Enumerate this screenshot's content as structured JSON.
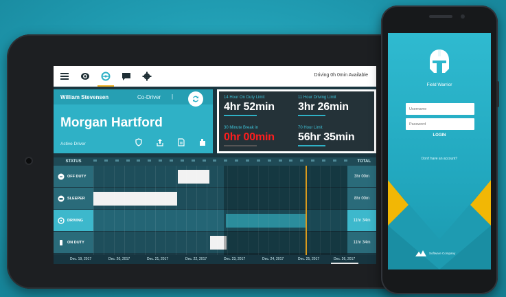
{
  "tablet": {
    "topbar": {
      "icons": [
        "menu-icon",
        "eye-icon",
        "steering-wheel-icon",
        "chat-icon",
        "gear-icon"
      ],
      "availability": "Driving 0h 0min Available"
    },
    "driver_card": {
      "driver": "William Stevensen",
      "codriver_label": "Co-Driver",
      "codriver_sep": "|",
      "name": "Morgan Hartford",
      "role": "Active Driver"
    },
    "limits": [
      {
        "label": "14 Hour On Duty Limit",
        "value": "4hr 52min"
      },
      {
        "label": "11 Hour Driving Limit",
        "value": "3hr 26min"
      },
      {
        "label": "30 Minute Break in",
        "value": "0hr 00min",
        "color": "#ff1e1e"
      },
      {
        "label": "70 Hour Limit",
        "value": "56hr 35min"
      }
    ],
    "grid": {
      "status_header": "STATUS",
      "total_header": "TOTAL",
      "rows": [
        {
          "label": "OFF DUTY",
          "total": "3hr 00m"
        },
        {
          "label": "SLEEPER",
          "total": "8hr 00m"
        },
        {
          "label": "DRIVING",
          "total": "11hr 34m"
        },
        {
          "label": "ON DUTY",
          "total": "11hr 34m"
        }
      ],
      "dates": [
        "Dec. 19, 2017",
        "Dec. 20, 2017",
        "Dec. 21, 2017",
        "Dec. 22, 2017",
        "Dec. 23, 2017",
        "Dec. 24, 2017",
        "Dec. 25, 2017",
        "Dec. 26, 2017"
      ]
    }
  },
  "phone": {
    "app_name": "Field Warrior",
    "username_placeholder": "Username",
    "password_placeholder": "Password",
    "login_label": "LOGIN",
    "no_account": "Don't have an account?",
    "brand": "Software Company"
  },
  "colors": {
    "accent": "#2fb1c6",
    "warning": "#ff1e1e",
    "now_line": "#d99a1c",
    "phone_yellow": "#f2b705"
  }
}
